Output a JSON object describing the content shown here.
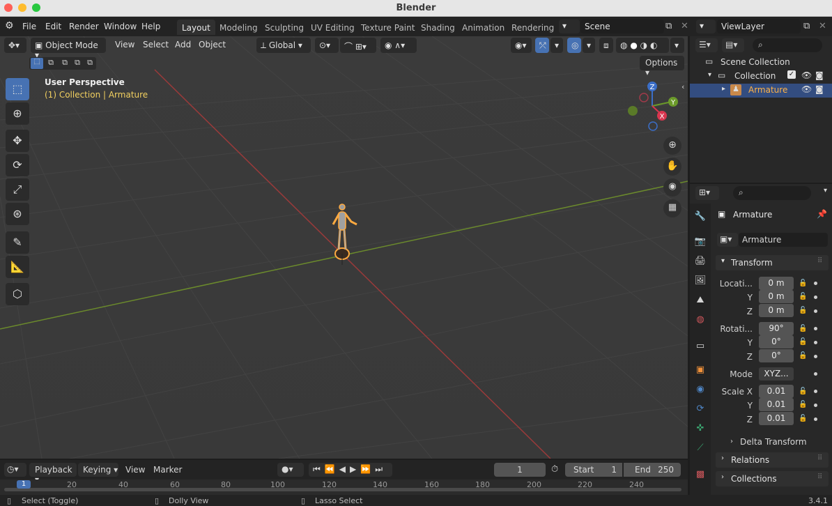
{
  "window": {
    "title": "Blender"
  },
  "menu": [
    "File",
    "Edit",
    "Render",
    "Window",
    "Help"
  ],
  "workspaces": [
    "Layout",
    "Modeling",
    "Sculpting",
    "UV Editing",
    "Texture Paint",
    "Shading",
    "Animation",
    "Rendering"
  ],
  "active_workspace": "Layout",
  "scene": "Scene",
  "view_layer": "ViewLayer",
  "viewport": {
    "mode": "Object Mode",
    "menus": [
      "View",
      "Select",
      "Add",
      "Object"
    ],
    "orientation": "Global",
    "options_label": "Options",
    "perspective": "User Perspective",
    "context": "(1) Collection | Armature",
    "axes": {
      "x": "X",
      "y": "Y",
      "z": "Z"
    }
  },
  "outliner": {
    "scene_collection": "Scene Collection",
    "collection": "Collection",
    "object": "Armature"
  },
  "properties": {
    "object_name": "Armature",
    "data_name": "Armature",
    "transform_title": "Transform",
    "location_label": "Locati...",
    "rotation_label": "Rotati...",
    "mode_label": "Mode",
    "scale_label": "Scale X",
    "y_label": "Y",
    "z_label": "Z",
    "location": [
      "0 m",
      "0 m",
      "0 m"
    ],
    "rotation": [
      "90°",
      "0°",
      "0°"
    ],
    "mode": "XYZ...",
    "scale": [
      "0.01",
      "0.01",
      "0.01"
    ],
    "delta_transform": "Delta Transform",
    "relations": "Relations",
    "collections": "Collections"
  },
  "timeline": {
    "menus": [
      "Playback",
      "Keying",
      "View",
      "Marker"
    ],
    "current_frame": "1",
    "start_label": "Start",
    "start": "1",
    "end_label": "End",
    "end": "250",
    "playhead": "1",
    "ticks": [
      "20",
      "40",
      "60",
      "80",
      "100",
      "120",
      "140",
      "160",
      "180",
      "200",
      "220",
      "240"
    ]
  },
  "status": {
    "select": "Select (Toggle)",
    "dolly": "Dolly View",
    "lasso": "Lasso Select",
    "version": "3.4.1"
  },
  "colors": {
    "accent": "#4772b3",
    "selection": "#ffaa40",
    "x_axis": "#9a3a3a",
    "y_axis": "#6b8a2c"
  }
}
